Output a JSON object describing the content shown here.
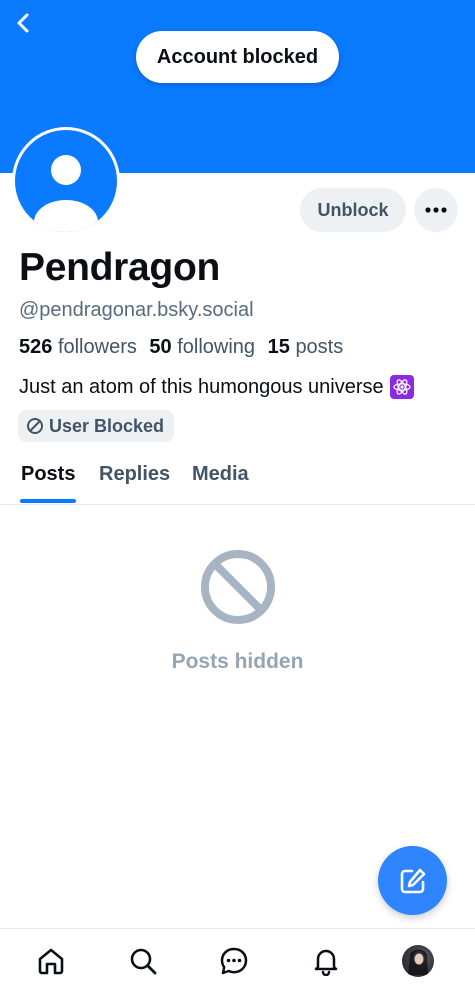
{
  "header": {
    "status_pill": "Account blocked",
    "back_icon": "chevron-left-icon",
    "banner_color": "#0a7aff"
  },
  "profile": {
    "display_name": "Pendragon",
    "handle": "@pendragonar.bsky.social",
    "followers_count": "526",
    "followers_label": "followers",
    "following_count": "50",
    "following_label": "following",
    "posts_count": "15",
    "posts_label": "posts",
    "bio": "Just an atom of this humongous universe",
    "bio_emoji": "atom-symbol-emoji",
    "blocked_badge": "User Blocked"
  },
  "actions": {
    "unblock_label": "Unblock",
    "more_icon": "more-horizontal-icon"
  },
  "tabs": [
    {
      "label": "Posts",
      "active": true
    },
    {
      "label": "Replies",
      "active": false
    },
    {
      "label": "Media",
      "active": false
    }
  ],
  "feed": {
    "empty_icon": "prohibited-icon",
    "empty_label": "Posts hidden"
  },
  "fab": {
    "icon": "compose-icon"
  },
  "bottom_nav": [
    {
      "icon": "home-icon"
    },
    {
      "icon": "search-icon"
    },
    {
      "icon": "chat-icon"
    },
    {
      "icon": "bell-icon"
    },
    {
      "icon": "profile-avatar"
    }
  ],
  "colors": {
    "accent": "#0a7aff",
    "muted_text": "#425466",
    "pill_bg": "#eef1f4"
  }
}
